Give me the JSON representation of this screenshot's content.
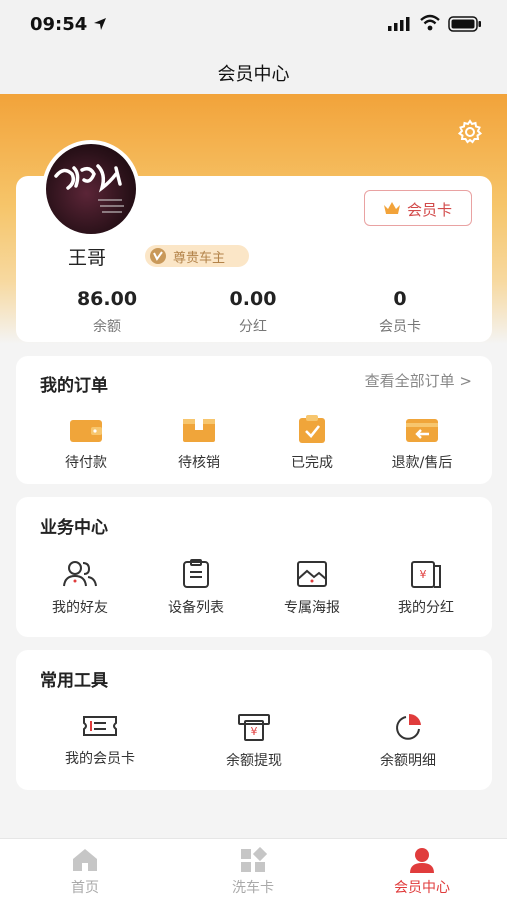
{
  "status_bar": {
    "time": "09:54"
  },
  "nav": {
    "title": "会员中心"
  },
  "profile": {
    "name": "王哥",
    "badge": "尊贵车主",
    "member_card_button": "会员卡",
    "stats": [
      {
        "value": "86.00",
        "label": "余额"
      },
      {
        "value": "0.00",
        "label": "分红"
      },
      {
        "value": "0",
        "label": "会员卡"
      }
    ]
  },
  "orders": {
    "title": "我的订单",
    "view_all": "查看全部订单 >",
    "items": [
      {
        "label": "待付款",
        "icon": "wallet-icon"
      },
      {
        "label": "待核销",
        "icon": "box-icon"
      },
      {
        "label": "已完成",
        "icon": "clipboard-check-icon"
      },
      {
        "label": "退款/售后",
        "icon": "refund-card-icon"
      }
    ]
  },
  "business": {
    "title": "业务中心",
    "items": [
      {
        "label": "我的好友",
        "icon": "friends-icon"
      },
      {
        "label": "设备列表",
        "icon": "device-list-icon"
      },
      {
        "label": "专属海报",
        "icon": "poster-icon"
      },
      {
        "label": "我的分红",
        "icon": "dividend-icon"
      }
    ]
  },
  "tools": {
    "title": "常用工具",
    "items": [
      {
        "label": "我的会员卡",
        "icon": "ticket-icon"
      },
      {
        "label": "余额提现",
        "icon": "withdraw-icon"
      },
      {
        "label": "余额明细",
        "icon": "pie-chart-icon"
      }
    ]
  },
  "tabs": [
    {
      "label": "首页",
      "icon": "home-icon"
    },
    {
      "label": "洗车卡",
      "icon": "grid-icon"
    },
    {
      "label": "会员中心",
      "icon": "user-icon",
      "active": true
    }
  ],
  "colors": {
    "accent_orange": "#f2a33a",
    "active_red": "#e03c3c"
  }
}
